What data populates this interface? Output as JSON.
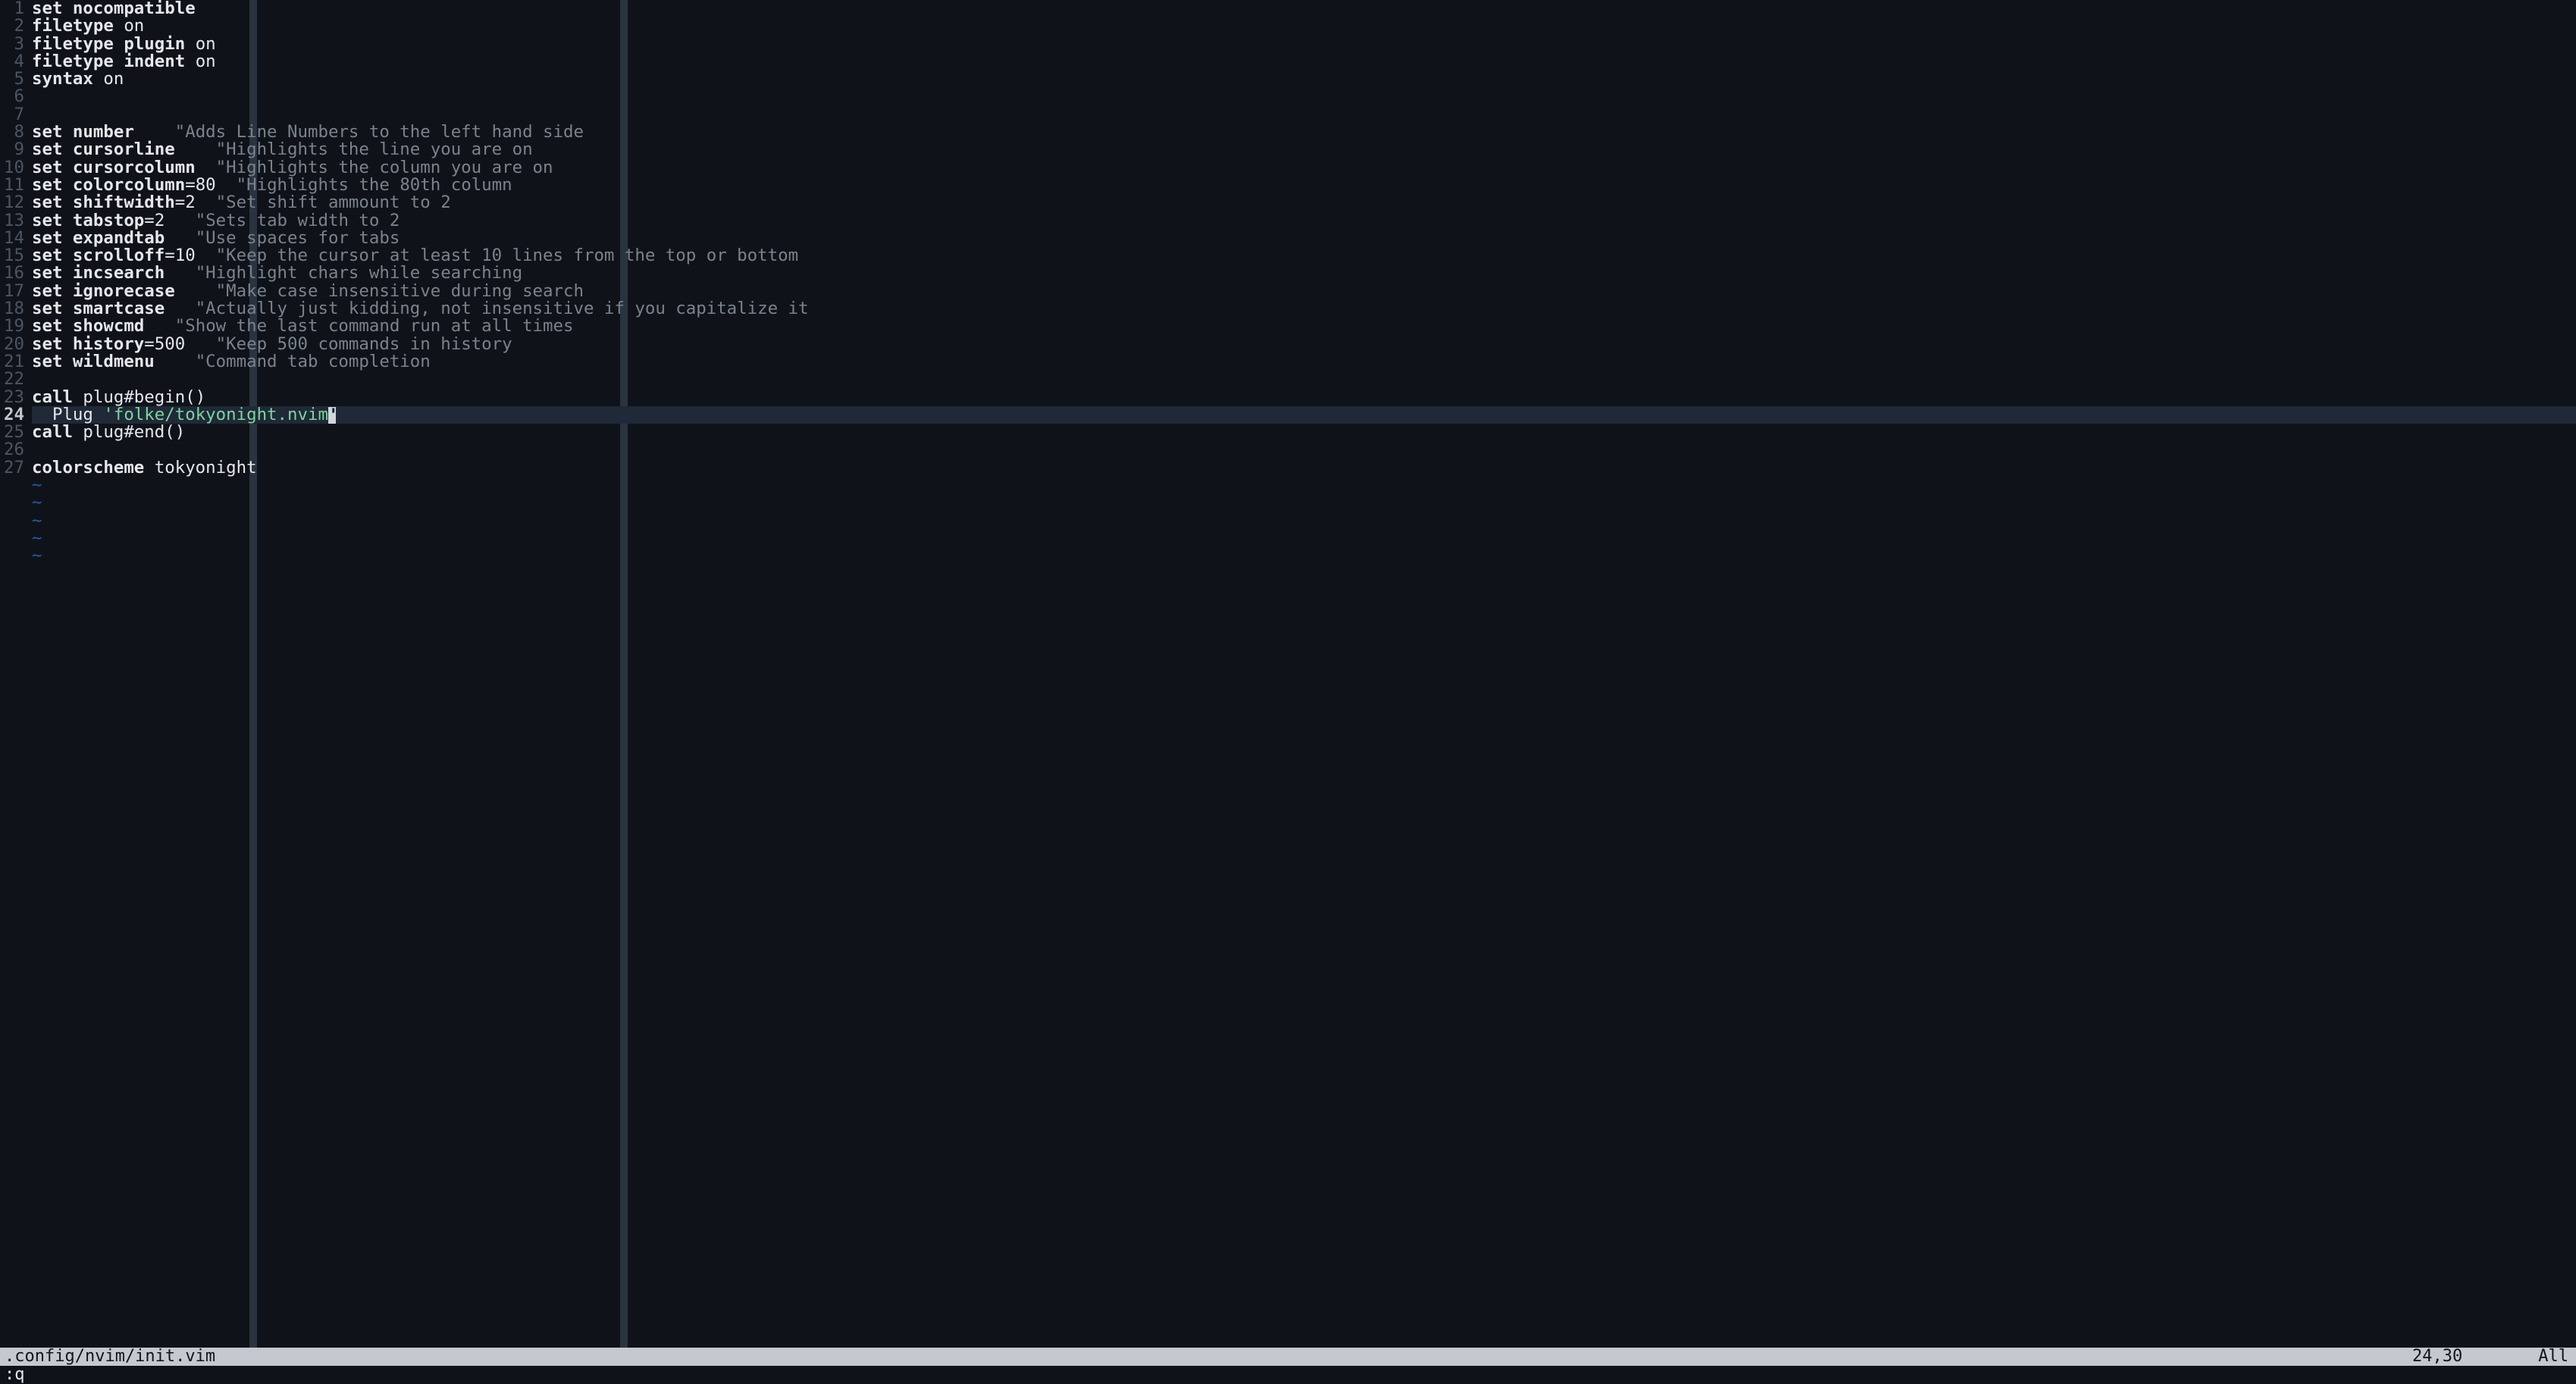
{
  "file_path": ".config/nvim/init.vim",
  "cursor_position": "24,30",
  "scroll_pct": "All",
  "command_line": ":q",
  "cursor": {
    "line": 24,
    "col": 30,
    "char": "'"
  },
  "color_column": 80,
  "tilde_rows": 5,
  "lines": [
    {
      "n": 1,
      "segs": [
        [
          "kw",
          "set "
        ],
        [
          "opt",
          "nocompatible"
        ]
      ]
    },
    {
      "n": 2,
      "segs": [
        [
          "kw",
          "filetype "
        ],
        [
          "val",
          "on"
        ]
      ]
    },
    {
      "n": 3,
      "segs": [
        [
          "kw",
          "filetype "
        ],
        [
          "opt",
          "plugin "
        ],
        [
          "val",
          "on"
        ]
      ]
    },
    {
      "n": 4,
      "segs": [
        [
          "kw",
          "filetype "
        ],
        [
          "opt",
          "indent "
        ],
        [
          "val",
          "on"
        ]
      ]
    },
    {
      "n": 5,
      "segs": [
        [
          "kw",
          "syntax "
        ],
        [
          "val",
          "on"
        ]
      ]
    },
    {
      "n": 6,
      "segs": []
    },
    {
      "n": 7,
      "segs": []
    },
    {
      "n": 8,
      "segs": [
        [
          "kw",
          "set "
        ],
        [
          "opt",
          "number"
        ],
        [
          "plain",
          "    "
        ],
        [
          "com",
          "\"Adds Line Numbers to the left hand side"
        ]
      ]
    },
    {
      "n": 9,
      "segs": [
        [
          "kw",
          "set "
        ],
        [
          "opt",
          "cursorline"
        ],
        [
          "plain",
          "    "
        ],
        [
          "com",
          "\"Highlights the line you are on"
        ]
      ]
    },
    {
      "n": 10,
      "segs": [
        [
          "kw",
          "set "
        ],
        [
          "opt",
          "cursorcolumn"
        ],
        [
          "plain",
          "  "
        ],
        [
          "com",
          "\"Highlights the column you are on"
        ]
      ]
    },
    {
      "n": 11,
      "segs": [
        [
          "kw",
          "set "
        ],
        [
          "opt",
          "colorcolumn"
        ],
        [
          "val",
          "=80"
        ],
        [
          "plain",
          "  "
        ],
        [
          "com",
          "\"Highlights the 80th column"
        ]
      ]
    },
    {
      "n": 12,
      "segs": [
        [
          "kw",
          "set "
        ],
        [
          "opt",
          "shiftwidth"
        ],
        [
          "val",
          "=2"
        ],
        [
          "plain",
          "  "
        ],
        [
          "com",
          "\"Set shift ammount to 2"
        ]
      ]
    },
    {
      "n": 13,
      "segs": [
        [
          "kw",
          "set "
        ],
        [
          "opt",
          "tabstop"
        ],
        [
          "val",
          "=2"
        ],
        [
          "plain",
          "   "
        ],
        [
          "com",
          "\"Sets tab width to 2"
        ]
      ]
    },
    {
      "n": 14,
      "segs": [
        [
          "kw",
          "set "
        ],
        [
          "opt",
          "expandtab"
        ],
        [
          "plain",
          "   "
        ],
        [
          "com",
          "\"Use spaces for tabs"
        ]
      ]
    },
    {
      "n": 15,
      "segs": [
        [
          "kw",
          "set "
        ],
        [
          "opt",
          "scrolloff"
        ],
        [
          "val",
          "=10"
        ],
        [
          "plain",
          "  "
        ],
        [
          "com",
          "\"Keep the cursor at least 10 lines from the top or bottom"
        ]
      ]
    },
    {
      "n": 16,
      "segs": [
        [
          "kw",
          "set "
        ],
        [
          "opt",
          "incsearch"
        ],
        [
          "plain",
          "   "
        ],
        [
          "com",
          "\"Highlight chars while searching"
        ]
      ]
    },
    {
      "n": 17,
      "segs": [
        [
          "kw",
          "set "
        ],
        [
          "opt",
          "ignorecase"
        ],
        [
          "plain",
          "    "
        ],
        [
          "com",
          "\"Make case insensitive during search"
        ]
      ]
    },
    {
      "n": 18,
      "segs": [
        [
          "kw",
          "set "
        ],
        [
          "opt",
          "smartcase"
        ],
        [
          "plain",
          "   "
        ],
        [
          "com",
          "\"Actually just kidding, not insensitive if you capitalize it"
        ]
      ]
    },
    {
      "n": 19,
      "segs": [
        [
          "kw",
          "set "
        ],
        [
          "opt",
          "showcmd"
        ],
        [
          "plain",
          "   "
        ],
        [
          "com",
          "\"Show the last command run at all times"
        ]
      ]
    },
    {
      "n": 20,
      "segs": [
        [
          "kw",
          "set "
        ],
        [
          "opt",
          "history"
        ],
        [
          "val",
          "=500"
        ],
        [
          "plain",
          "   "
        ],
        [
          "com",
          "\"Keep 500 commands in history"
        ]
      ]
    },
    {
      "n": 21,
      "segs": [
        [
          "kw",
          "set "
        ],
        [
          "opt",
          "wildmenu"
        ],
        [
          "plain",
          "    "
        ],
        [
          "com",
          "\"Command tab completion"
        ]
      ]
    },
    {
      "n": 22,
      "segs": []
    },
    {
      "n": 23,
      "segs": [
        [
          "kw",
          "call "
        ],
        [
          "fn",
          "plug#begin()"
        ]
      ]
    },
    {
      "n": 24,
      "segs": [
        [
          "plain",
          "  "
        ],
        [
          "fn",
          "Plug "
        ],
        [
          "str",
          "'folke/tokyonight.nvim"
        ]
      ],
      "cursor": true
    },
    {
      "n": 25,
      "segs": [
        [
          "kw",
          "call "
        ],
        [
          "fn",
          "plug#end()"
        ]
      ]
    },
    {
      "n": 26,
      "segs": []
    },
    {
      "n": 27,
      "segs": [
        [
          "kw",
          "colorscheme "
        ],
        [
          "plain",
          "tokyonight"
        ]
      ]
    }
  ]
}
